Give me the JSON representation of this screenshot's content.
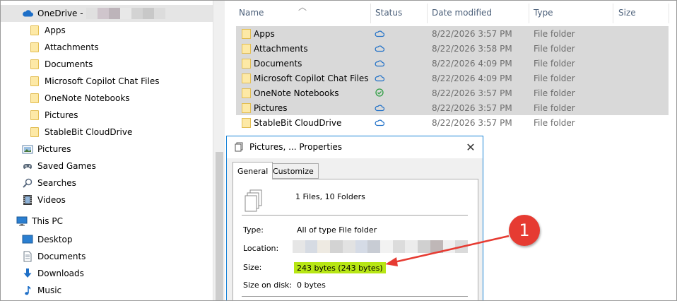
{
  "nav": {
    "onedrive_label": "OneDrive -",
    "onedrive_children": [
      "Apps",
      "Attachments",
      "Documents",
      "Microsoft Copilot Chat Files",
      "OneNote Notebooks",
      "Pictures",
      "StableBit CloudDrive"
    ],
    "user_items": [
      "Pictures",
      "Saved Games",
      "Searches",
      "Videos"
    ],
    "this_pc_label": "This PC",
    "pc_items": [
      "Desktop",
      "Documents",
      "Downloads",
      "Music"
    ]
  },
  "columns": {
    "name": "Name",
    "status": "Status",
    "date": "Date modified",
    "type": "File folder",
    "type_header": "Type",
    "size": "Size"
  },
  "rows": [
    {
      "name": "Apps",
      "date": "8/22/2026 3:57 PM",
      "type": "File folder",
      "status": "cloud",
      "selected": true
    },
    {
      "name": "Attachments",
      "date": "8/22/2026 3:58 PM",
      "type": "File folder",
      "status": "cloud",
      "selected": true
    },
    {
      "name": "Documents",
      "date": "8/22/2026 4:09 PM",
      "type": "File folder",
      "status": "cloud",
      "selected": true
    },
    {
      "name": "Microsoft Copilot Chat Files",
      "date": "8/22/2026 4:09 PM",
      "type": "File folder",
      "status": "cloud",
      "selected": true
    },
    {
      "name": "OneNote Notebooks",
      "date": "8/22/2026 3:57 PM",
      "type": "File folder",
      "status": "synced",
      "selected": true
    },
    {
      "name": "Pictures",
      "date": "8/22/2026 3:57 PM",
      "type": "File folder",
      "status": "cloud",
      "selected": true
    },
    {
      "name": "StableBit CloudDrive",
      "date": "8/22/2026 3:57 PM",
      "type": "File folder",
      "status": "cloud",
      "selected": false
    }
  ],
  "dialog": {
    "title": "Pictures, ... Properties",
    "tabs": [
      "General",
      "Customize"
    ],
    "files_count": "1 Files, 10 Folders",
    "type_label": "Type:",
    "type_value": "All of type File folder",
    "location_label": "Location:",
    "size_label": "Size:",
    "size_value": "243 bytes (243 bytes)",
    "size_on_disk_label": "Size on disk:",
    "size_on_disk_value": "0 bytes"
  },
  "annotation": {
    "number": "1"
  },
  "colors": {
    "accent_border": "#1883d7",
    "highlight": "#b7e614",
    "badge": "#e63b32",
    "cloud_icon": "#1e6fc7",
    "synced_icon": "#2f9e44"
  }
}
